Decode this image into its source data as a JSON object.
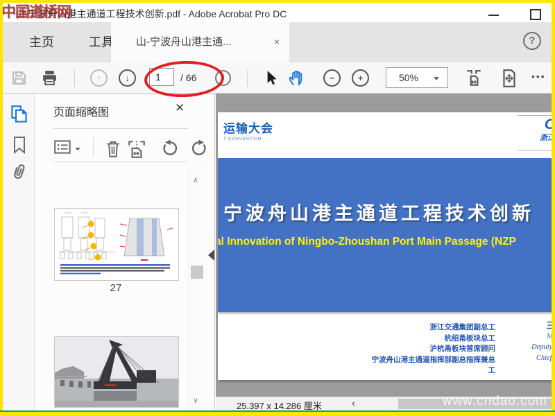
{
  "window": {
    "title": "山-宁波舟山港主通道工程技术创新.pdf - Adobe Acrobat Pro DC",
    "watermark_top_left": "中国道桥网"
  },
  "glyphs": {
    "help": "?",
    "close_tab": "×",
    "close_panel": "✕",
    "more": "•••",
    "up": "↑",
    "down": "↓",
    "spin_up": "▲",
    "spin_down": "▼",
    "scroll_up": "∧",
    "scroll_down": "∨",
    "chevron_left": "‹",
    "minus": "−",
    "plus": "+"
  },
  "tabs": {
    "home": "主页",
    "tools": "工具",
    "document": "山-宁波舟山港主通..."
  },
  "toolbar": {
    "page_current": "1",
    "page_total": "/ 66",
    "zoom_level": "50%"
  },
  "panel": {
    "title": "页面缩略图",
    "thumb1_label": "27"
  },
  "doc": {
    "logo_left_line1": "运输大会",
    "logo_left_line2": "T CONVENTION",
    "logo_right_letter": "C",
    "logo_right_text": "浙江",
    "title_zh": "宁波舟山港主通道工程技术创新",
    "title_en": "al Innovation of Ningbo-Zhoushan Port Main Passage (NZP",
    "credits": [
      "浙江交通集团副总工",
      "杭绍甬板块总工",
      "沪杭甬板块首席顾问",
      "宁波舟山港主通道指挥部副总指挥兼总",
      "工"
    ],
    "credits_en": [
      "三",
      "Mi",
      "Deputy Chief",
      "Chief Eng"
    ]
  },
  "status": {
    "page_size": "25.397 x 14.286 厘米",
    "watermark": "www.cndao.com"
  },
  "colors": {
    "accent_blue": "#2478d6",
    "banner_blue": "#4372c4",
    "highlight_yellow": "#ffe500",
    "annotation_red": "#de1f26",
    "title_text_yellow": "#fff200"
  }
}
